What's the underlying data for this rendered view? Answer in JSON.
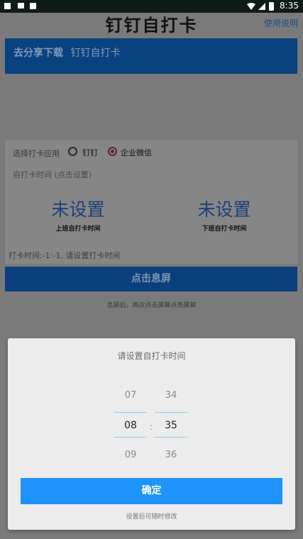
{
  "status_bar": {
    "time": "8:35",
    "icons": [
      "square-icon",
      "message-icon",
      "download-icon",
      "wifi-icon",
      "signal-icon",
      "battery-icon"
    ]
  },
  "app": {
    "title": "钉钉自打卡",
    "help_link": "使用说明",
    "share_banner": {
      "part1": "去分享下载",
      "part2": "钉钉自打卡"
    },
    "choose_app_label": "选择打卡应用",
    "options": [
      {
        "label": "钉钉",
        "selected": false
      },
      {
        "label": "企业微信",
        "selected": true
      }
    ],
    "time_hint": "自打卡时间 (点击设置)",
    "start_time": {
      "value": "未设置",
      "label": "上班自打卡时间"
    },
    "end_time": {
      "value": "未设置",
      "label": "下班自打卡时间"
    },
    "clock_status": "打卡时间:-1:-1, 请设置打卡时间",
    "sleep_button": "点击息屏",
    "sleep_hint": "息屏后，两次点击屏幕点亮屏幕"
  },
  "dialog": {
    "title": "请设置自打卡时间",
    "hours": {
      "prev": "07",
      "selected": "08",
      "next": "09"
    },
    "minutes": {
      "prev": "34",
      "selected": "35",
      "next": "36"
    },
    "separator": ":",
    "confirm": "确定",
    "note": "设置后可随时修改"
  },
  "colors": {
    "accent": "#1e93fb",
    "dim_overlay": "#7a7a7a",
    "picker_line": "#8fcdee"
  }
}
